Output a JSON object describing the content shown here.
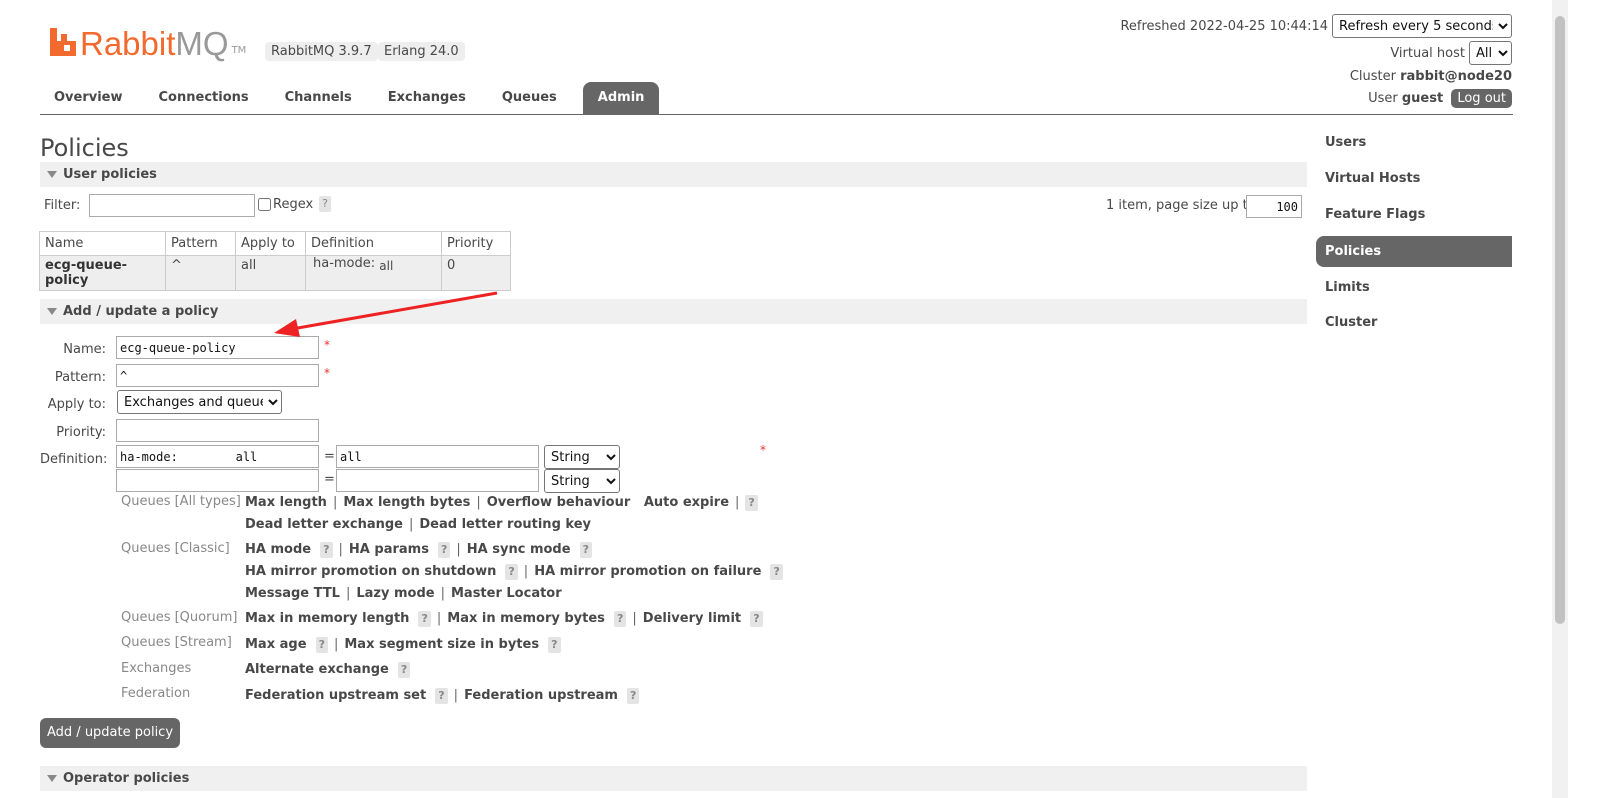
{
  "header": {
    "logo_word_a": "Rabbit",
    "logo_word_b": "MQ",
    "logo_tm": "TM",
    "version": "RabbitMQ 3.9.7",
    "erlang": "Erlang 24.0",
    "refreshed": "Refreshed 2022-04-25 10:44:14",
    "refresh_select": "Refresh every 5 seconds",
    "vhost_label": "Virtual host",
    "vhost_select": "All",
    "cluster_label": "Cluster",
    "cluster_value": "rabbit@node20",
    "user_label": "User",
    "user_value": "guest",
    "logout": "Log out"
  },
  "tabs": [
    "Overview",
    "Connections",
    "Channels",
    "Exchanges",
    "Queues",
    "Admin"
  ],
  "sidebar": [
    "Users",
    "Virtual Hosts",
    "Feature Flags",
    "Policies",
    "Limits",
    "Cluster"
  ],
  "page_title": "Policies",
  "user_policies": {
    "title": "User policies",
    "filter_label": "Filter:",
    "regex_label": "Regex",
    "help": "?",
    "paging_text": "1 item, page size up to",
    "page_size": "100",
    "columns": [
      "Name",
      "Pattern",
      "Apply to",
      "Definition",
      "Priority"
    ],
    "row": {
      "name": "ecg-queue-policy",
      "pattern": "^",
      "apply_to": "all",
      "definition_key": "ha-mode:",
      "definition_value": "all",
      "priority": "0"
    }
  },
  "add_policy": {
    "title": "Add / update a policy",
    "name_label": "Name:",
    "name_value": "ecg-queue-policy",
    "pattern_label": "Pattern:",
    "pattern_value": "^",
    "apply_label": "Apply to:",
    "apply_value": "Exchanges and queues",
    "priority_label": "Priority:",
    "definition_label": "Definition:",
    "def1_key": "ha-mode:        all",
    "def1_value": "all",
    "def_type": "String",
    "equals": "=",
    "required": "*",
    "button": "Add / update policy"
  },
  "categories": [
    {
      "label": "Queues [All types]",
      "lines": [
        [
          "Max length",
          "Max length bytes",
          "Overflow behaviour",
          "Auto expire"
        ],
        [
          "Dead letter exchange",
          "Dead letter routing key"
        ]
      ]
    },
    {
      "label": "Queues [Classic]",
      "lines": [
        [
          "HA mode",
          "HA params",
          "HA sync mode"
        ],
        [
          "HA mirror promotion on shutdown",
          "HA mirror promotion on failure"
        ],
        [
          "Message TTL",
          "Lazy mode",
          "Master Locator"
        ]
      ]
    },
    {
      "label": "Queues [Quorum]",
      "lines": [
        [
          "Max in memory length",
          "Max in memory bytes",
          "Delivery limit"
        ]
      ]
    },
    {
      "label": "Queues [Stream]",
      "lines": [
        [
          "Max age",
          "Max segment size in bytes"
        ]
      ]
    },
    {
      "label": "Exchanges",
      "lines": [
        [
          "Alternate exchange"
        ]
      ]
    },
    {
      "label": "Federation",
      "lines": [
        [
          "Federation upstream set",
          "Federation upstream"
        ]
      ]
    }
  ],
  "operator_policies": {
    "title": "Operator policies"
  },
  "colors": {
    "brand": "#f26a2e",
    "dark_tab": "#666666",
    "annotation_arrow": "#ee2222"
  }
}
